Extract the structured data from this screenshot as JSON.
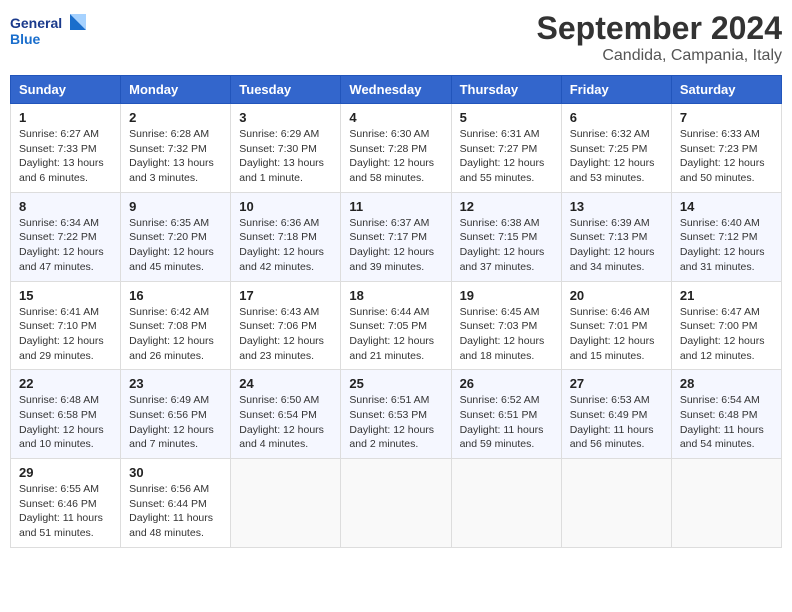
{
  "logo": {
    "general": "General",
    "blue": "Blue"
  },
  "title": "September 2024",
  "location": "Candida, Campania, Italy",
  "headers": [
    "Sunday",
    "Monday",
    "Tuesday",
    "Wednesday",
    "Thursday",
    "Friday",
    "Saturday"
  ],
  "weeks": [
    [
      {
        "day": "1",
        "sunrise": "6:27 AM",
        "sunset": "7:33 PM",
        "daylight": "13 hours and 6 minutes."
      },
      {
        "day": "2",
        "sunrise": "6:28 AM",
        "sunset": "7:32 PM",
        "daylight": "13 hours and 3 minutes."
      },
      {
        "day": "3",
        "sunrise": "6:29 AM",
        "sunset": "7:30 PM",
        "daylight": "13 hours and 1 minute."
      },
      {
        "day": "4",
        "sunrise": "6:30 AM",
        "sunset": "7:28 PM",
        "daylight": "12 hours and 58 minutes."
      },
      {
        "day": "5",
        "sunrise": "6:31 AM",
        "sunset": "7:27 PM",
        "daylight": "12 hours and 55 minutes."
      },
      {
        "day": "6",
        "sunrise": "6:32 AM",
        "sunset": "7:25 PM",
        "daylight": "12 hours and 53 minutes."
      },
      {
        "day": "7",
        "sunrise": "6:33 AM",
        "sunset": "7:23 PM",
        "daylight": "12 hours and 50 minutes."
      }
    ],
    [
      {
        "day": "8",
        "sunrise": "6:34 AM",
        "sunset": "7:22 PM",
        "daylight": "12 hours and 47 minutes."
      },
      {
        "day": "9",
        "sunrise": "6:35 AM",
        "sunset": "7:20 PM",
        "daylight": "12 hours and 45 minutes."
      },
      {
        "day": "10",
        "sunrise": "6:36 AM",
        "sunset": "7:18 PM",
        "daylight": "12 hours and 42 minutes."
      },
      {
        "day": "11",
        "sunrise": "6:37 AM",
        "sunset": "7:17 PM",
        "daylight": "12 hours and 39 minutes."
      },
      {
        "day": "12",
        "sunrise": "6:38 AM",
        "sunset": "7:15 PM",
        "daylight": "12 hours and 37 minutes."
      },
      {
        "day": "13",
        "sunrise": "6:39 AM",
        "sunset": "7:13 PM",
        "daylight": "12 hours and 34 minutes."
      },
      {
        "day": "14",
        "sunrise": "6:40 AM",
        "sunset": "7:12 PM",
        "daylight": "12 hours and 31 minutes."
      }
    ],
    [
      {
        "day": "15",
        "sunrise": "6:41 AM",
        "sunset": "7:10 PM",
        "daylight": "12 hours and 29 minutes."
      },
      {
        "day": "16",
        "sunrise": "6:42 AM",
        "sunset": "7:08 PM",
        "daylight": "12 hours and 26 minutes."
      },
      {
        "day": "17",
        "sunrise": "6:43 AM",
        "sunset": "7:06 PM",
        "daylight": "12 hours and 23 minutes."
      },
      {
        "day": "18",
        "sunrise": "6:44 AM",
        "sunset": "7:05 PM",
        "daylight": "12 hours and 21 minutes."
      },
      {
        "day": "19",
        "sunrise": "6:45 AM",
        "sunset": "7:03 PM",
        "daylight": "12 hours and 18 minutes."
      },
      {
        "day": "20",
        "sunrise": "6:46 AM",
        "sunset": "7:01 PM",
        "daylight": "12 hours and 15 minutes."
      },
      {
        "day": "21",
        "sunrise": "6:47 AM",
        "sunset": "7:00 PM",
        "daylight": "12 hours and 12 minutes."
      }
    ],
    [
      {
        "day": "22",
        "sunrise": "6:48 AM",
        "sunset": "6:58 PM",
        "daylight": "12 hours and 10 minutes."
      },
      {
        "day": "23",
        "sunrise": "6:49 AM",
        "sunset": "6:56 PM",
        "daylight": "12 hours and 7 minutes."
      },
      {
        "day": "24",
        "sunrise": "6:50 AM",
        "sunset": "6:54 PM",
        "daylight": "12 hours and 4 minutes."
      },
      {
        "day": "25",
        "sunrise": "6:51 AM",
        "sunset": "6:53 PM",
        "daylight": "12 hours and 2 minutes."
      },
      {
        "day": "26",
        "sunrise": "6:52 AM",
        "sunset": "6:51 PM",
        "daylight": "11 hours and 59 minutes."
      },
      {
        "day": "27",
        "sunrise": "6:53 AM",
        "sunset": "6:49 PM",
        "daylight": "11 hours and 56 minutes."
      },
      {
        "day": "28",
        "sunrise": "6:54 AM",
        "sunset": "6:48 PM",
        "daylight": "11 hours and 54 minutes."
      }
    ],
    [
      {
        "day": "29",
        "sunrise": "6:55 AM",
        "sunset": "6:46 PM",
        "daylight": "11 hours and 51 minutes."
      },
      {
        "day": "30",
        "sunrise": "6:56 AM",
        "sunset": "6:44 PM",
        "daylight": "11 hours and 48 minutes."
      },
      null,
      null,
      null,
      null,
      null
    ]
  ]
}
